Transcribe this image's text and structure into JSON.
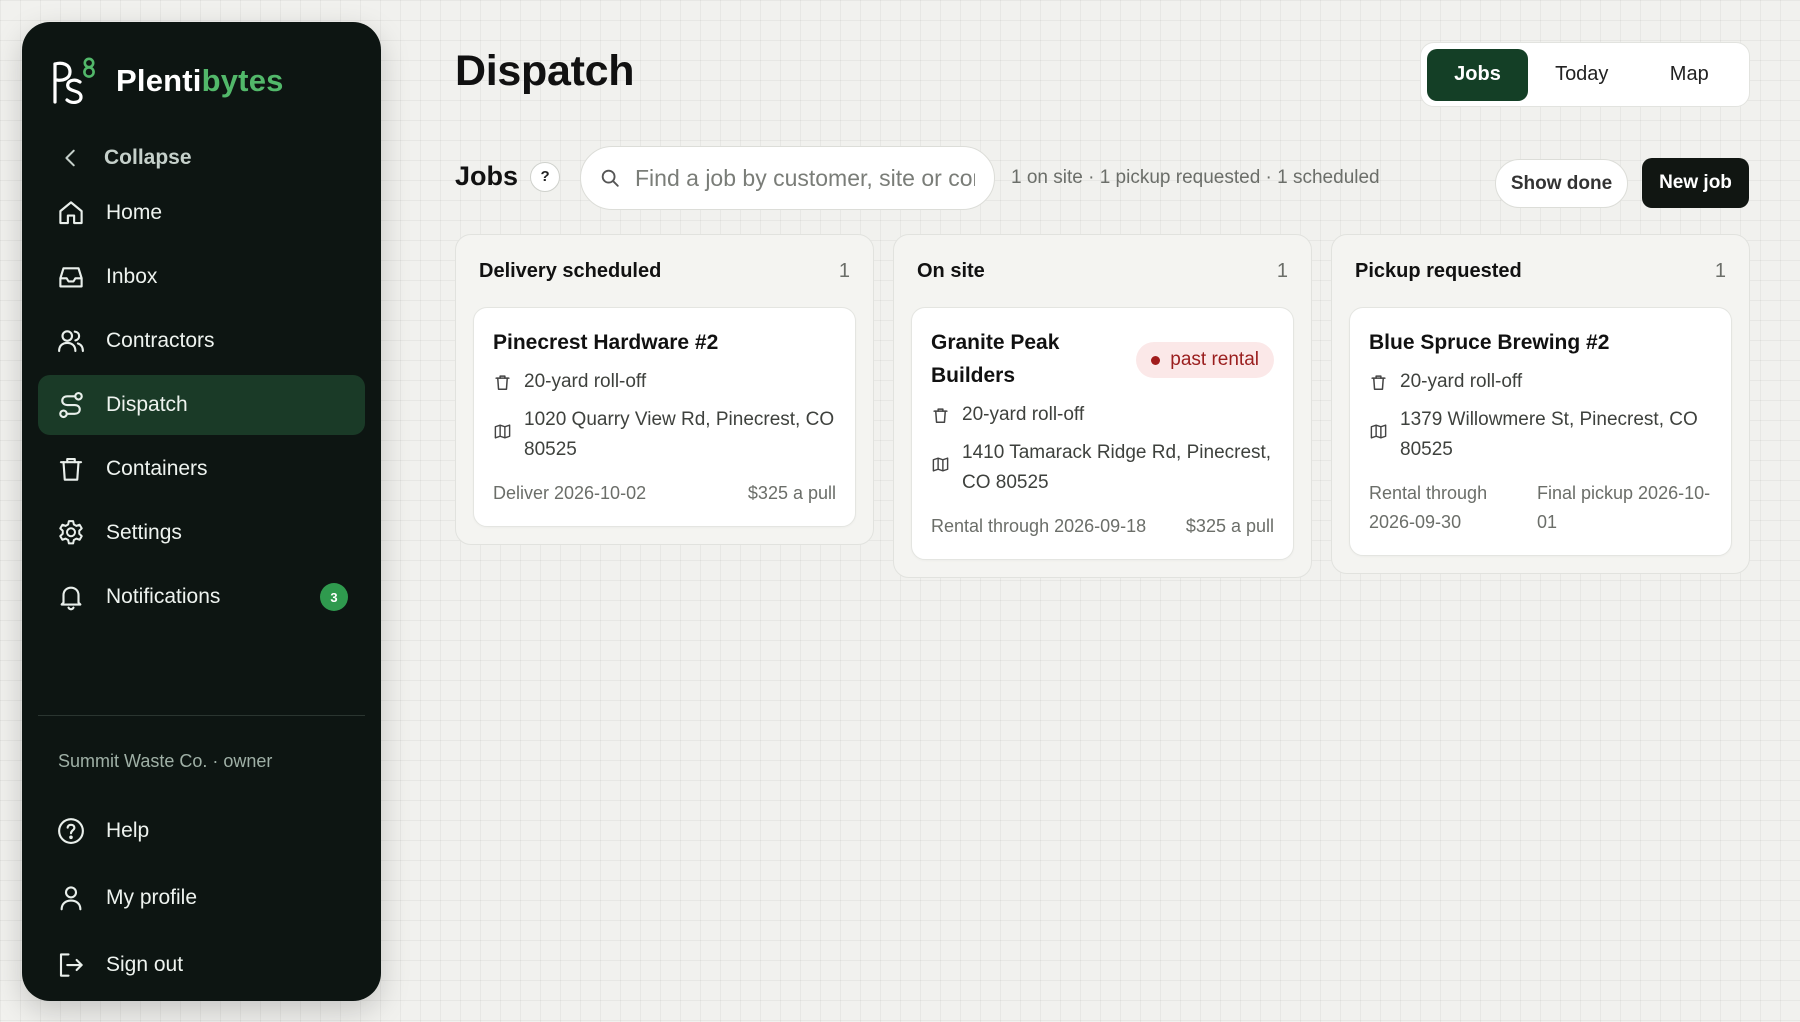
{
  "app": {
    "brand_prefix": "Plenti",
    "brand_suffix": "bytes",
    "brand_accent_color": "#52b86a"
  },
  "sidebar": {
    "collapse_label": "Collapse",
    "items": [
      {
        "label": "Home",
        "icon": "home-icon",
        "active": false
      },
      {
        "label": "Inbox",
        "icon": "inbox-icon",
        "active": false
      },
      {
        "label": "Contractors",
        "icon": "users-icon",
        "active": false
      },
      {
        "label": "Dispatch",
        "icon": "route-icon",
        "active": true
      },
      {
        "label": "Containers",
        "icon": "trash-icon",
        "active": false
      },
      {
        "label": "Settings",
        "icon": "gear-icon",
        "active": false
      },
      {
        "label": "Notifications",
        "icon": "bell-icon",
        "active": false,
        "badge": "3"
      }
    ],
    "org_line": "Summit Waste Co. · owner",
    "bottom_items": [
      {
        "label": "Help",
        "icon": "help-circle-icon"
      },
      {
        "label": "My profile",
        "icon": "user-icon"
      },
      {
        "label": "Sign out",
        "icon": "sign-out-icon"
      }
    ]
  },
  "header": {
    "title": "Dispatch",
    "view_tabs": [
      {
        "label": "Jobs",
        "active": true
      },
      {
        "label": "Today",
        "active": false
      },
      {
        "label": "Map",
        "active": false
      }
    ]
  },
  "jobs_toolbar": {
    "title": "Jobs",
    "help_label": "?",
    "search_placeholder": "Find a job by customer, site or contractor",
    "search_value": "",
    "summary": "1 on site · 1 pickup requested · 1 scheduled",
    "show_done_label": "Show done",
    "new_job_label": "New job"
  },
  "columns": [
    {
      "title": "Delivery scheduled",
      "count": "1",
      "cards": [
        {
          "name": "Pinecrest Hardware #2",
          "container": "20-yard roll-off",
          "address": "1020 Quarry View Rd, Pinecrest, CO 80525",
          "foot_left": "Deliver 2026-10-02",
          "foot_right": "$325 a pull"
        }
      ]
    },
    {
      "title": "On site",
      "count": "1",
      "cards": [
        {
          "name": "Granite Peak Builders",
          "badge": "past rental",
          "container": "20-yard roll-off",
          "address": "1410 Tamarack Ridge Rd, Pinecrest, CO 80525",
          "foot_left": "Rental through 2026-09-18",
          "foot_right": "$325 a pull"
        }
      ]
    },
    {
      "title": "Pickup requested",
      "count": "1",
      "cards": [
        {
          "name": "Blue Spruce Brewing #2",
          "container": "20-yard roll-off",
          "address": "1379 Willowmere St, Pinecrest, CO 80525",
          "foot_left": "Rental through 2026-09-30",
          "foot_right": "Final pickup 2026-10-01"
        }
      ]
    }
  ]
}
